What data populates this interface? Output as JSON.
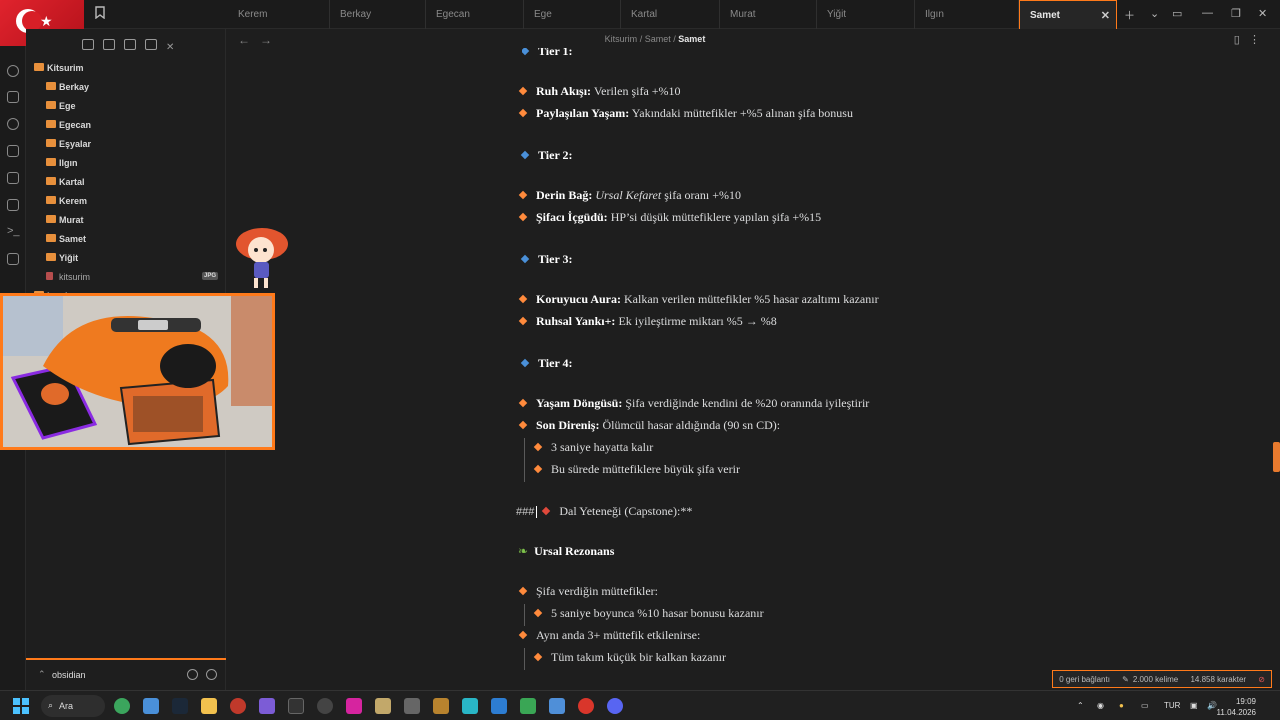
{
  "tabs": [
    {
      "label": "Kerem"
    },
    {
      "label": "Berkay"
    },
    {
      "label": "Egecan"
    },
    {
      "label": "Ege"
    },
    {
      "label": "Kartal"
    },
    {
      "label": "Murat"
    },
    {
      "label": "Yiğit"
    },
    {
      "label": "Ilgın"
    },
    {
      "label": "Samet",
      "active": true
    }
  ],
  "breadcrumb": {
    "part1": "Kitsurim",
    "sep": "/",
    "part2": "Samet",
    "current": "Samet"
  },
  "sidebar": {
    "root": "Kitsurim",
    "folders": [
      "Berkay",
      "Ege",
      "Egecan",
      "Eşyalar",
      "Ilgın",
      "Kartal",
      "Kerem",
      "Murat",
      "Samet",
      "Yiğit"
    ],
    "file": {
      "name": "kitsurim",
      "badge": "JPG"
    },
    "partial": "locales",
    "vault_name": "obsidian"
  },
  "content": {
    "tier1_heading": "Tier 1:",
    "t1a_bold": "Ruh Akışı:",
    "t1a_text": " Verilen şifa +%10",
    "t1b_bold": "Paylaşılan Yaşam:",
    "t1b_text": " Yakındaki müttefikler +%5 alınan şifa bonusu",
    "tier2_heading": "Tier 2:",
    "t2a_bold": "Derin Bağ:",
    "t2a_em": "Ursal Kefaret",
    "t2a_text": " şifa oranı +%10",
    "t2b_bold": "Şifacı İçgüdü:",
    "t2b_text": " HP’si düşük müttefiklere yapılan şifa +%15",
    "tier3_heading": "Tier 3:",
    "t3a_bold": "Koruyucu Aura:",
    "t3a_text": " Kalkan verilen müttefikler %5 hasar azaltımı kazanır",
    "t3b_bold": "Ruhsal Yankı+:",
    "t3b_text": " Ek iyileştirme miktarı %5 → %8",
    "tier4_heading": "Tier 4:",
    "t4a_bold": "Yaşam Döngüsü:",
    "t4a_text": " Şifa verdiğinde kendini de %20 oranında iyileştirir",
    "t4b_bold": "Son Direniş:",
    "t4b_text": " Ölümcül hasar aldığında (90 sn CD):",
    "t4b_sub1": "3 saniye hayatta kalır",
    "t4b_sub2": "Bu sürede müttefiklere büyük şifa verir",
    "capstone_prefix": "###",
    "capstone_text": "Dal Yeteneği (Capstone):**",
    "ursal_heading": "Ursal Rezonans",
    "ur_a": "Şifa verdiğin müttefikler:",
    "ur_a_sub": "5 saniye boyunca %10 hasar bonusu kazanır",
    "ur_b": "Aynı anda 3+ müttefik etkilenirse:",
    "ur_b_sub": "Tüm takım küçük bir kalkan kazanır"
  },
  "status": {
    "backlinks": "0 geri bağlantı",
    "words": "2.000 kelime",
    "chars": "14.858 karakter"
  },
  "taskbar": {
    "search_label": "Ara",
    "lang": "TUR",
    "time": "19:09",
    "date": "11.04.2026"
  },
  "colors": {
    "accent": "#ff7a1a",
    "bullet": "#ff8a3c",
    "tier_bullet": "#4a90d9"
  }
}
